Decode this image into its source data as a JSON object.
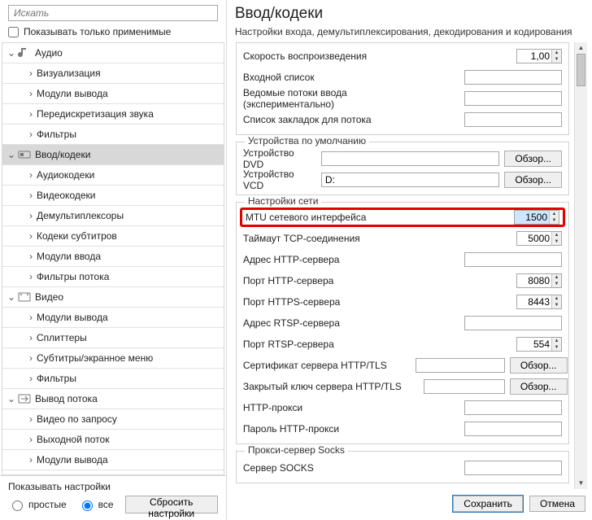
{
  "sidebar": {
    "search_placeholder": "Искать",
    "checkbox_label": "Показывать только применимые",
    "tree": [
      {
        "label": "Аудио",
        "level": 0,
        "expanded": true,
        "icon": "audio"
      },
      {
        "label": "Визуализация",
        "level": 1
      },
      {
        "label": "Модули вывода",
        "level": 1
      },
      {
        "label": "Передискретизация звука",
        "level": 1
      },
      {
        "label": "Фильтры",
        "level": 1
      },
      {
        "label": "Ввод/кодеки",
        "level": 0,
        "expanded": true,
        "selected": true,
        "icon": "codec"
      },
      {
        "label": "Аудиокодеки",
        "level": 1
      },
      {
        "label": "Видеокодеки",
        "level": 1
      },
      {
        "label": "Демультиплексоры",
        "level": 1
      },
      {
        "label": "Кодеки субтитров",
        "level": 1
      },
      {
        "label": "Модули ввода",
        "level": 1
      },
      {
        "label": "Фильтры потока",
        "level": 1
      },
      {
        "label": "Видео",
        "level": 0,
        "expanded": true,
        "icon": "video"
      },
      {
        "label": "Модули вывода",
        "level": 1
      },
      {
        "label": "Сплиттеры",
        "level": 1
      },
      {
        "label": "Субтитры/экранное меню",
        "level": 1
      },
      {
        "label": "Фильтры",
        "level": 1
      },
      {
        "label": "Вывод потока",
        "level": 0,
        "expanded": true,
        "icon": "stream"
      },
      {
        "label": "Видео по запросу",
        "level": 1
      },
      {
        "label": "Выходной поток",
        "level": 1
      },
      {
        "label": "Модули вывода",
        "level": 1
      }
    ],
    "bottom": {
      "title": "Показывать настройки",
      "radio_simple": "простые",
      "radio_all": "все",
      "reset": "Сбросить настройки"
    }
  },
  "main": {
    "title": "Ввод/кодеки",
    "subtitle": "Настройки входа, демультиплексирования, декодирования и кодирования",
    "group1": {
      "rows": {
        "playback_speed": {
          "label": "Скорость воспроизведения",
          "value": "1,00"
        },
        "input_list": {
          "label": "Входной список",
          "value": ""
        },
        "slave_inputs": {
          "label": "Ведомые потоки ввода (экспериментально)",
          "value": ""
        },
        "bookmarks": {
          "label": "Список закладок для потока",
          "value": ""
        }
      }
    },
    "devices": {
      "title": "Устройства по умолчанию",
      "dvd": {
        "label": "Устройство DVD",
        "value": "",
        "browse": "Обзор..."
      },
      "vcd": {
        "label": "Устройство VCD",
        "value": "D:",
        "browse": "Обзор..."
      }
    },
    "network": {
      "title": "Настройки сети",
      "mtu": {
        "label": "MTU сетевого интерфейса",
        "value": "1500"
      },
      "tcp_timeout": {
        "label": "Таймаут TCP-соединения",
        "value": "5000"
      },
      "http_addr": {
        "label": "Адрес HTTP-сервера",
        "value": ""
      },
      "http_port": {
        "label": "Порт HTTP-сервера",
        "value": "8080"
      },
      "https_port": {
        "label": "Порт HTTPS-сервера",
        "value": "8443"
      },
      "rtsp_addr": {
        "label": "Адрес RTSP-сервера",
        "value": ""
      },
      "rtsp_port": {
        "label": "Порт RTSP-сервера",
        "value": "554"
      },
      "tls_cert": {
        "label": "Сертификат сервера HTTP/TLS",
        "value": "",
        "browse": "Обзор..."
      },
      "tls_key": {
        "label": "Закрытый ключ сервера HTTP/TLS",
        "value": "",
        "browse": "Обзор..."
      },
      "http_proxy": {
        "label": "HTTP-прокси",
        "value": ""
      },
      "http_pproxy": {
        "label": "Пароль HTTP-прокси",
        "value": ""
      }
    },
    "socks": {
      "title": "Прокси-сервер Socks",
      "server": {
        "label": "Сервер SOCKS",
        "value": ""
      }
    }
  },
  "footer": {
    "save": "Сохранить",
    "cancel": "Отмена"
  }
}
